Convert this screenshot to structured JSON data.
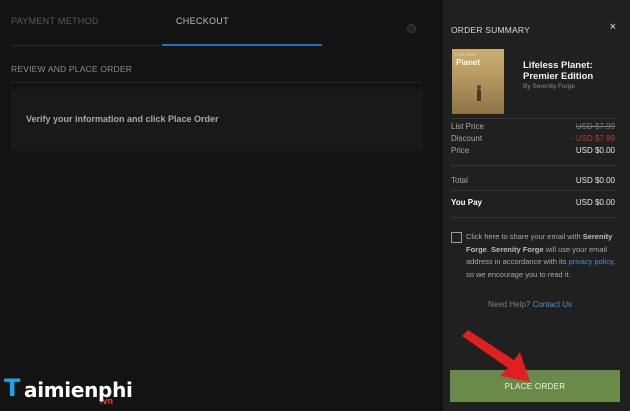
{
  "tabs": {
    "payment_method": "PAYMENT METHOD",
    "checkout": "CHECKOUT"
  },
  "review": {
    "title": "REVIEW AND PLACE ORDER",
    "verify_text": "Verify your information and click Place Order"
  },
  "summary": {
    "title": "ORDER SUMMARY",
    "close_icon": "×",
    "product": {
      "cover_top": "LIFELESS",
      "cover_name": "Planet",
      "title": "Lifeless Planet: Premier Edition",
      "developer": "By Serenity Forge"
    },
    "prices": {
      "list_price_label": "List Price",
      "list_price_value": "USD $7.99",
      "discount_label": "Discount",
      "discount_value": "- USD $7.99",
      "price_label": "Price",
      "price_value": "USD $0.00",
      "total_label": "Total",
      "total_value": "USD $0.00",
      "you_pay_label": "You Pay",
      "you_pay_value": "USD $0.00"
    },
    "share": {
      "text_1": "Click here to share your email with ",
      "dev_1": "Serenity Forge",
      "text_2": ". ",
      "dev_2": "Serenity Forge",
      "text_3": " will use your email address in accordance with its ",
      "privacy_link": "privacy policy",
      "text_4": ", so we encourage you to read it."
    },
    "help_text": "Need Help? ",
    "contact_link": "Contact Us",
    "place_order": "PLACE ORDER"
  },
  "watermark": {
    "t": "T",
    "rest": "aimienphi",
    "vn": ".vn"
  },
  "colors": {
    "accent_blue": "#1d6fc6",
    "place_order_green": "#6a8a4a",
    "discount_red": "#c0392b",
    "arrow_red": "#e02020"
  }
}
